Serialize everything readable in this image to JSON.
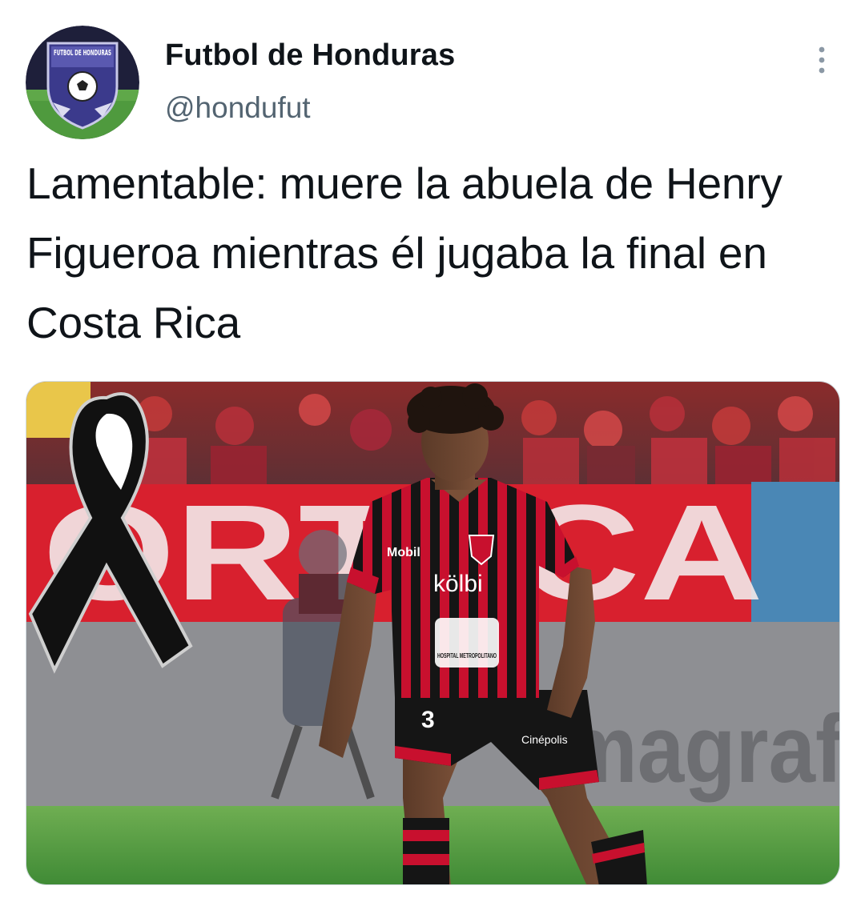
{
  "author": {
    "name": "Futbol de Honduras",
    "handle": "@hondufut",
    "avatar_badge_text": "FUTBOL DE HONDURAS"
  },
  "tweet": {
    "text": "Lamentable: muere la abuela de Henry Figueroa mientras él jugaba la final en Costa Rica"
  },
  "media": {
    "stadium_banner_text": "ORTSCA",
    "ground_ad_text": "Imagraf",
    "jersey": {
      "sponsor_sleeve": "Mobil",
      "sponsor_main": "kölbi",
      "sponsor_lower": "HOSPITAL METROPOLITANO",
      "shorts_number": "3",
      "shorts_sponsor": "Cinépolis"
    }
  },
  "icons": {
    "more": "more-vertical-icon",
    "ribbon": "mourning-ribbon-icon"
  },
  "colors": {
    "text_primary": "#0f1419",
    "text_secondary": "#536471",
    "jersey_red": "#c8102e",
    "jersey_black": "#151515",
    "avatar_purple": "#3b3a8c",
    "pitch_green": "#4f9a3e"
  }
}
